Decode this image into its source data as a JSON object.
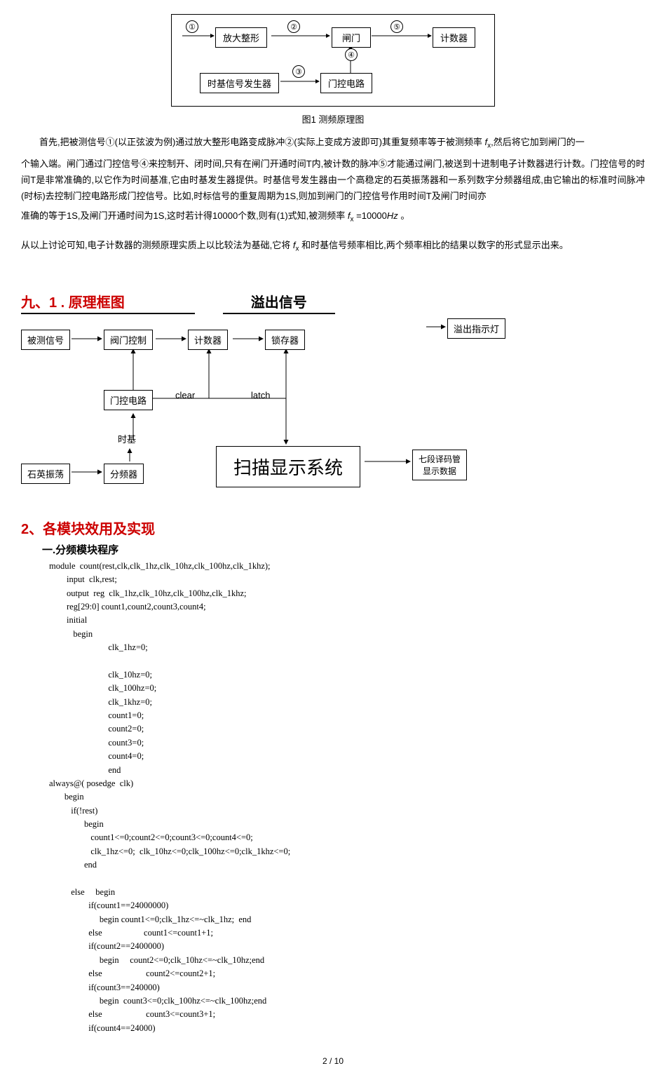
{
  "fig1": {
    "box_amp": "放大整形",
    "box_gate": "闸门",
    "box_counter": "计数器",
    "box_timebase": "时基信号发生器",
    "box_gatectrl": "门控电路",
    "num1": "①",
    "num2": "②",
    "num3": "③",
    "num4": "④",
    "num5": "⑤",
    "caption": "图1    测频原理图"
  },
  "para1_a": "首先,把被测信号①(以正弦波为例)通过放大整形电路变成脉冲②(实际上变成方波即可)其重复频率等于被测频率",
  "para1_fx": " f",
  "para1_fx_sub": "x",
  "para1_b": ",然后将它加到闸门的一",
  "para2": "个输入端。闸门通过门控信号④来控制开、闭时间,只有在闸门开通时间T内,被计数的脉冲⑤才能通过闸门,被送到十进制电子计数器进行计数。门控信号的时间T是非常准确的,以它作为时间基准,它由时基发生器提供。时基信号发生器由一个高稳定的石英振荡器和一系列数字分频器组成,由它输出的标准时间脉冲(时标)去控制门控电路形成门控信号。比如,时标信号的重复周期为1S,则加到闸门的门控信号作用时间T及闸门时间亦",
  "para3_a": "准确的等于1S,及闸门开通时间为1S,这时若计得10000个数,则有(1)式知,被测频率 ",
  "para3_fx": "f",
  "para3_fx_sub": "x",
  "para3_b": " =10000",
  "para3_hz": "Hz",
  "para3_c": " 。",
  "para4_a": "从以上讨论可知,电子计数器的测频原理实质上以比较法为基础,它将 ",
  "para4_fx": "f",
  "para4_fx_sub": "x",
  "para4_b": " 和时基信号频率相比,两个频率相比的结果以数字的形式显示出来。",
  "sec9_label": "九、1 . 原理框图",
  "overflow_title": "溢出信号",
  "diag2": {
    "b_measured": "被测信号",
    "b_gatectrl": "阀门控制",
    "b_counter": "计数器",
    "b_latch": "锁存器",
    "b_overflowled": "溢出指示灯",
    "b_gatecirc": "门控电路",
    "b_timebase": "时基",
    "b_xtal": "石英振荡",
    "b_divider": "分频器",
    "b_scan": "扫描显示系统",
    "b_decoder": "七段译码管\n显示数据",
    "lbl_clear": "clear",
    "lbl_latch": "latch"
  },
  "sec2_title": "2、各模块效用及实现",
  "sub_freq_title": "一.分频模块程序",
  "code": "module  count(rest,clk,clk_1hz,clk_10hz,clk_100hz,clk_1khz);\n        input  clk,rest;\n        output  reg  clk_1hz,clk_10hz,clk_100hz,clk_1khz;\n        reg[29:0] count1,count2,count3,count4;\n        initial\n           begin\n                           clk_1hz=0;\n\n                           clk_10hz=0;\n                           clk_100hz=0;\n                           clk_1khz=0;\n                           count1=0;\n                           count2=0;\n                           count3=0;\n                           count4=0;\n                           end\nalways@( posedge  clk)\n       begin\n          if(!rest)\n                begin\n                   count1<=0;count2<=0;count3<=0;count4<=0;\n                   clk_1hz<=0;  clk_10hz<=0;clk_100hz<=0;clk_1khz<=0;\n                end\n\n          else     begin\n                  if(count1==24000000)\n                       begin count1<=0;clk_1hz<=~clk_1hz;  end\n                  else                   count1<=count1+1;\n                  if(count2==2400000)\n                       begin     count2<=0;clk_10hz<=~clk_10hz;end\n                  else                    count2<=count2+1;\n                  if(count3==240000)\n                       begin  count3<=0;clk_100hz<=~clk_100hz;end\n                  else                    count3<=count3+1;\n                  if(count4==24000)",
  "page_num": "2 / 10"
}
